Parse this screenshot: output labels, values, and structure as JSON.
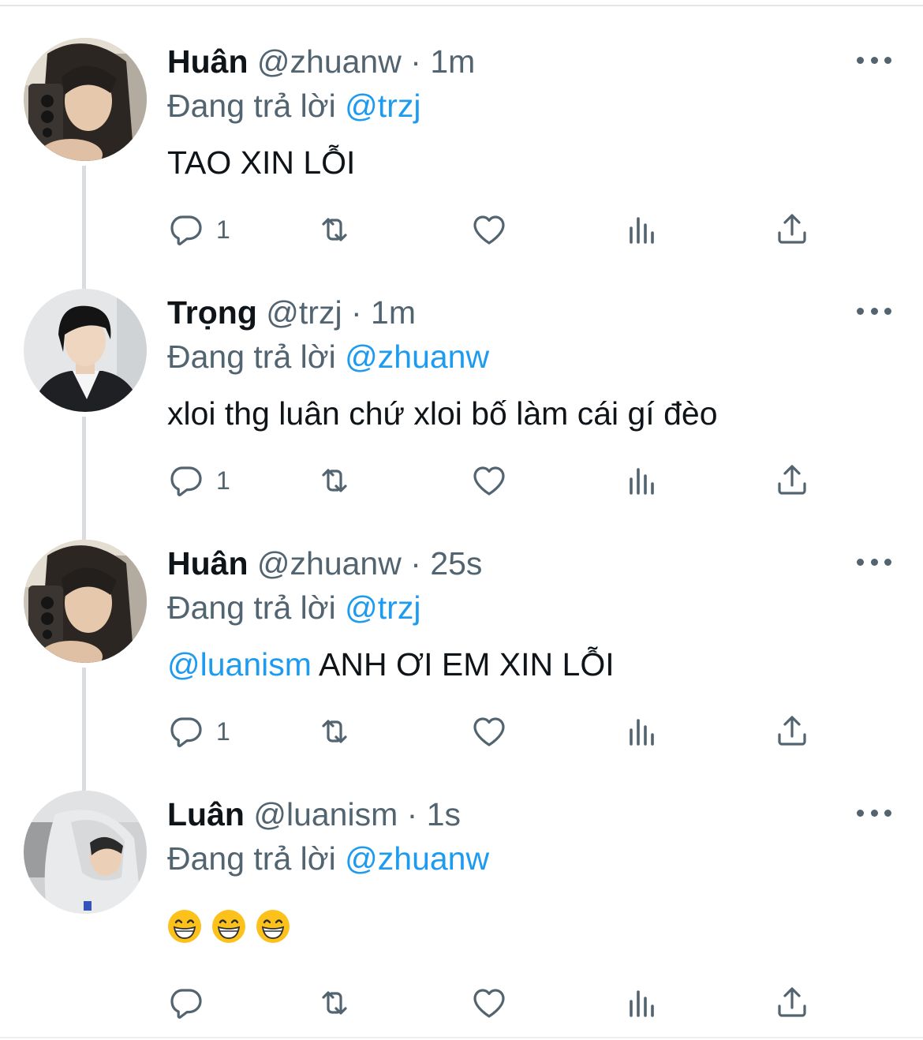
{
  "reply_prefix": "Đang trả lời",
  "tweets": [
    {
      "name": "Huân",
      "handle": "@zhuanw",
      "separator": "·",
      "time": "1m",
      "reply_to": "@trzj",
      "text": "TAO XIN LỖI",
      "reply_count": "1",
      "avatar": "avatar-huan"
    },
    {
      "name": "Trọng",
      "handle": "@trzj",
      "separator": "·",
      "time": "1m",
      "reply_to": "@zhuanw",
      "text": "xloi thg luân chứ xloi bố làm cái gí đèo",
      "reply_count": "1",
      "avatar": "avatar-trong"
    },
    {
      "name": "Huân",
      "handle": "@zhuanw",
      "separator": "·",
      "time": "25s",
      "reply_to": "@trzj",
      "text_mention": "@luanism",
      "text": " ANH ƠI EM XIN LỖI",
      "reply_count": "1",
      "avatar": "avatar-huan"
    },
    {
      "name": "Luân",
      "handle": "@luanism",
      "separator": "·",
      "time": "1s",
      "reply_to": "@zhuanw",
      "emojis": [
        "grinning-face-with-smiling-eyes",
        "grinning-face-with-smiling-eyes",
        "grinning-face-with-smiling-eyes"
      ],
      "reply_count": "",
      "avatar": "avatar-luan"
    }
  ],
  "colors": {
    "accent": "#1d9bf0",
    "secondary_text": "#536471",
    "primary_text": "#0f1419",
    "thread_line": "#d9dde0"
  },
  "icons": [
    "reply-icon",
    "retweet-icon",
    "like-icon",
    "views-icon",
    "share-icon",
    "more-icon"
  ]
}
